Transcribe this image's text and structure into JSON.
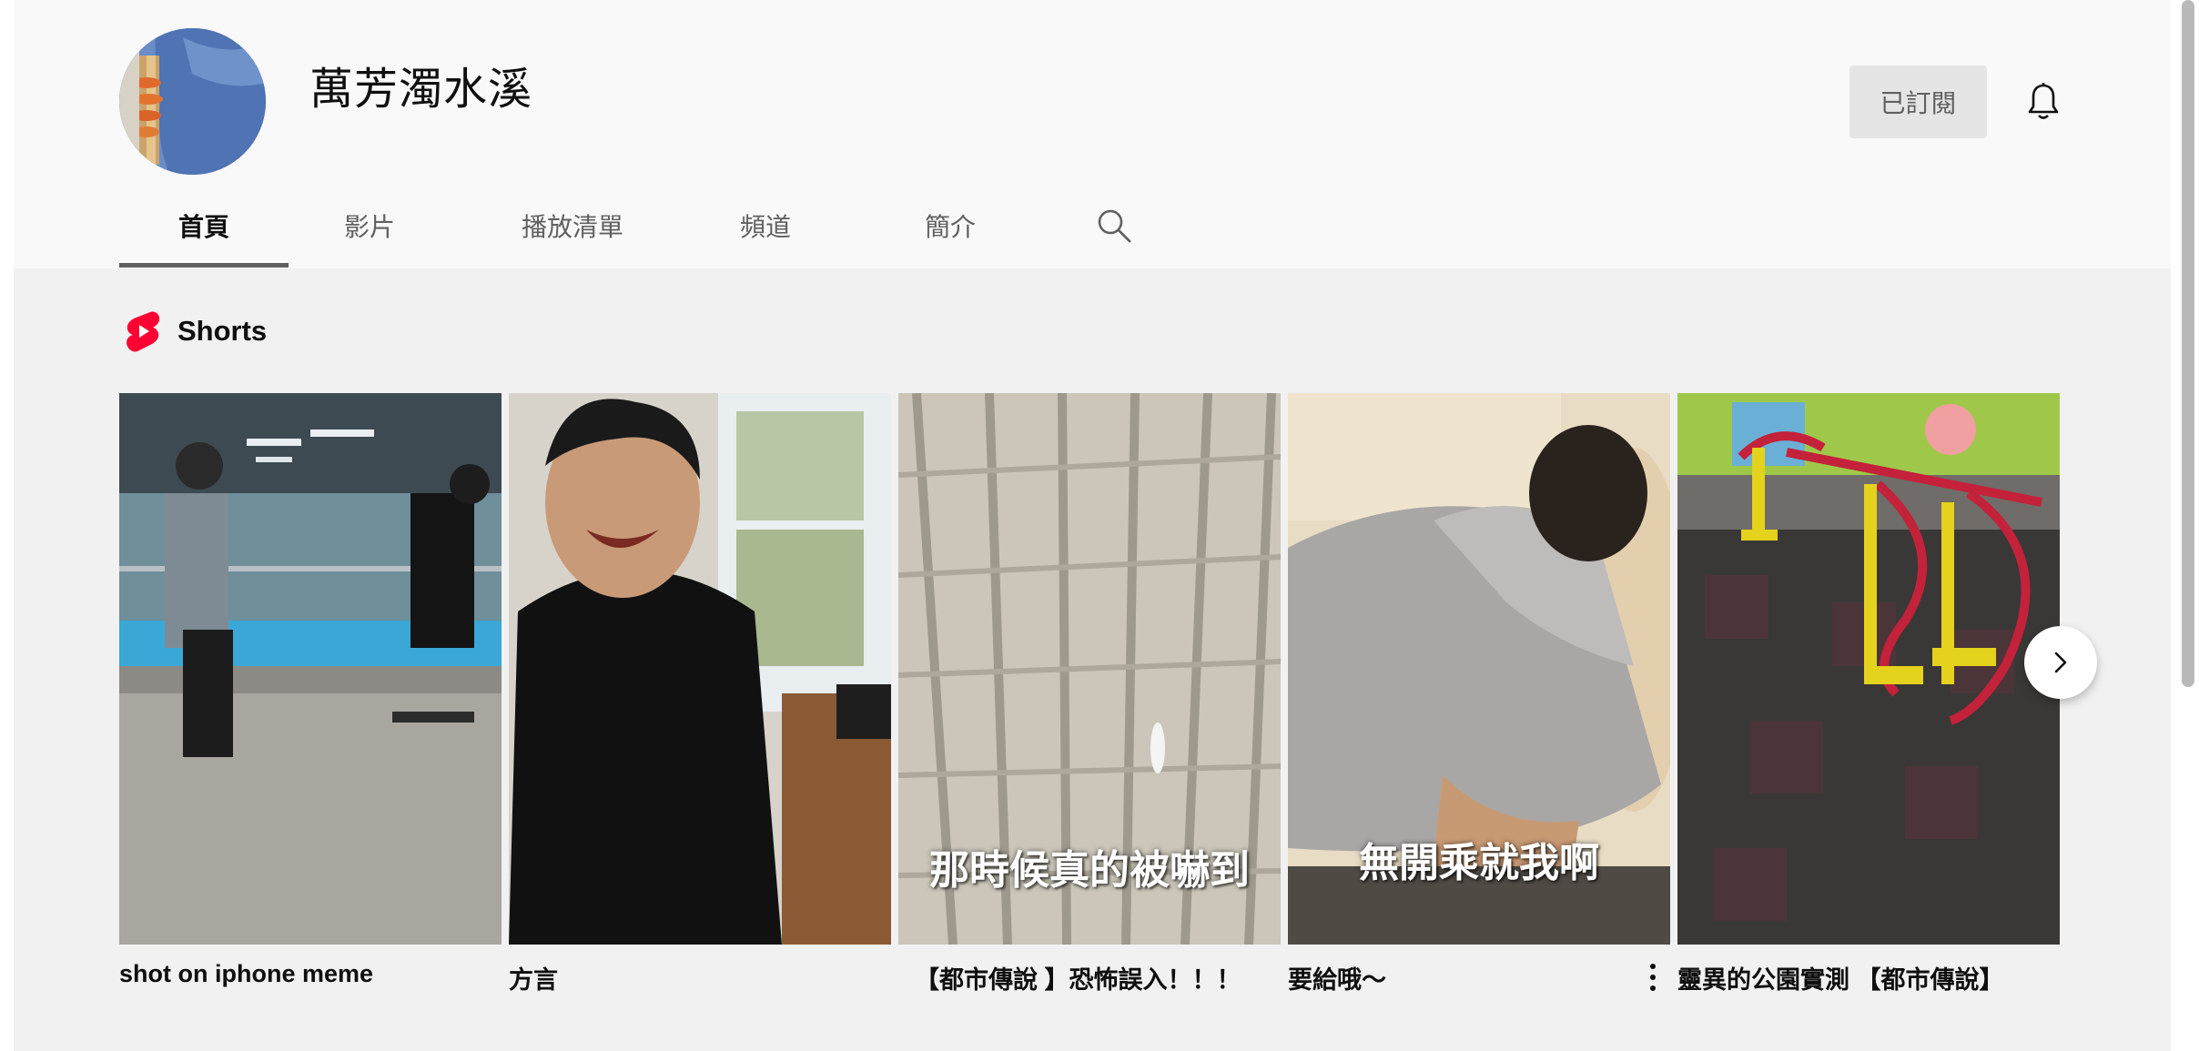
{
  "channel": {
    "name": "萬芳濁水溪",
    "subscribe_label": "已訂閱"
  },
  "tabs": [
    {
      "label": "首頁",
      "active": true
    },
    {
      "label": "影片",
      "active": false
    },
    {
      "label": "播放清單",
      "active": false
    },
    {
      "label": "頻道",
      "active": false
    },
    {
      "label": "簡介",
      "active": false
    }
  ],
  "shorts": {
    "section_title": "Shorts",
    "items": [
      {
        "title": "shot on iphone meme",
        "overlay": ""
      },
      {
        "title": "方言",
        "overlay": ""
      },
      {
        "title": "【都市傳說 】恐怖誤入！！！",
        "overlay": "那時候真的被嚇到"
      },
      {
        "title": "要給哦～",
        "overlay": "無開乘就我啊"
      },
      {
        "title": "靈異的公園實測 【都市傳說】",
        "overlay": ""
      }
    ]
  },
  "icons": {
    "bell": "bell-icon",
    "search": "search-icon",
    "shorts_logo": "shorts-logo-icon",
    "next": "chevron-right-icon",
    "more": "more-vertical-icon"
  },
  "colors": {
    "shorts_red": "#ff0033",
    "tab_underline": "#606060",
    "subscribed_bg": "#e5e5e5"
  }
}
